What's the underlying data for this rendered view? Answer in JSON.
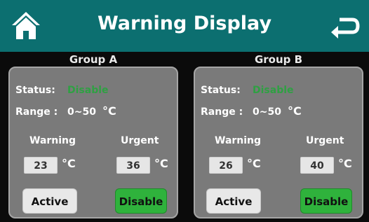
{
  "header": {
    "title": "Warning Display",
    "home_icon": "home-icon",
    "back_icon": "return-arrow-icon"
  },
  "colors": {
    "header_bg": "#0c6f70",
    "panel_bg": "#7a7a7a",
    "status_disable": "#2fa043",
    "disable_button": "#2fb23c"
  },
  "groups": [
    {
      "title": "Group A",
      "status_label": "Status:",
      "status_value": "Disable",
      "range_label": "Range :",
      "range_value": "0~50",
      "unit": "°C",
      "warning_label": "Warning",
      "urgent_label": "Urgent",
      "warning_value": "23",
      "urgent_value": "36",
      "active_button": "Active",
      "disable_button": "Disable"
    },
    {
      "title": "Group B",
      "status_label": "Status:",
      "status_value": "Disable",
      "range_label": "Range :",
      "range_value": "0~50",
      "unit": "°C",
      "warning_label": "Warning",
      "urgent_label": "Urgent",
      "warning_value": "26",
      "urgent_value": "40",
      "active_button": "Active",
      "disable_button": "Disable"
    }
  ]
}
